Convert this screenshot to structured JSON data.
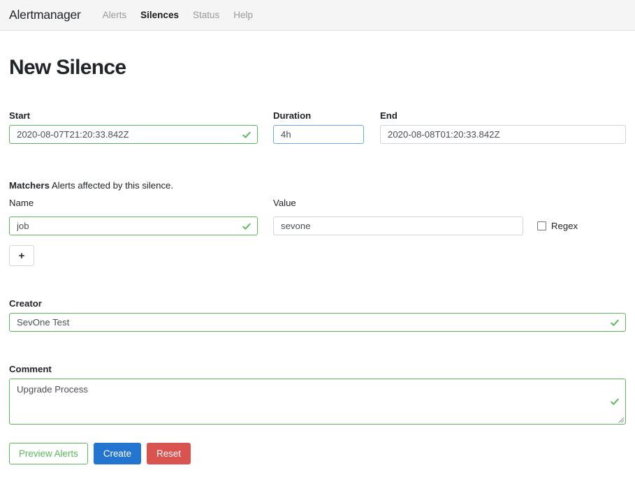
{
  "navbar": {
    "brand": "Alertmanager",
    "links": [
      {
        "label": "Alerts",
        "active": false
      },
      {
        "label": "Silences",
        "active": true
      },
      {
        "label": "Status",
        "active": false
      },
      {
        "label": "Help",
        "active": false
      }
    ]
  },
  "page": {
    "title": "New Silence"
  },
  "schedule": {
    "start_label": "Start",
    "start_value": "2020-08-07T21:20:33.842Z",
    "duration_label": "Duration",
    "duration_value": "4h",
    "end_label": "End",
    "end_value": "2020-08-08T01:20:33.842Z"
  },
  "matchers": {
    "heading": "Matchers",
    "description": "Alerts affected by this silence.",
    "name_label": "Name",
    "value_label": "Value",
    "regex_label": "Regex",
    "regex_checked": false,
    "rows": [
      {
        "name": "job",
        "value": "sevone"
      }
    ],
    "add_button_label": "+"
  },
  "creator": {
    "label": "Creator",
    "value": "SevOne Test"
  },
  "comment": {
    "label": "Comment",
    "value": "Upgrade Process"
  },
  "actions": {
    "preview_label": "Preview Alerts",
    "create_label": "Create",
    "reset_label": "Reset"
  },
  "icons": {
    "valid_check": "check-icon",
    "add": "plus-icon",
    "resize": "resize-grip-icon",
    "checkbox": "checkbox-icon"
  },
  "colors": {
    "success": "#5cb85c",
    "primary": "#2475d0",
    "danger": "#d9534f",
    "focus": "#6aa9e9",
    "navbar_bg": "#f5f5f5"
  }
}
